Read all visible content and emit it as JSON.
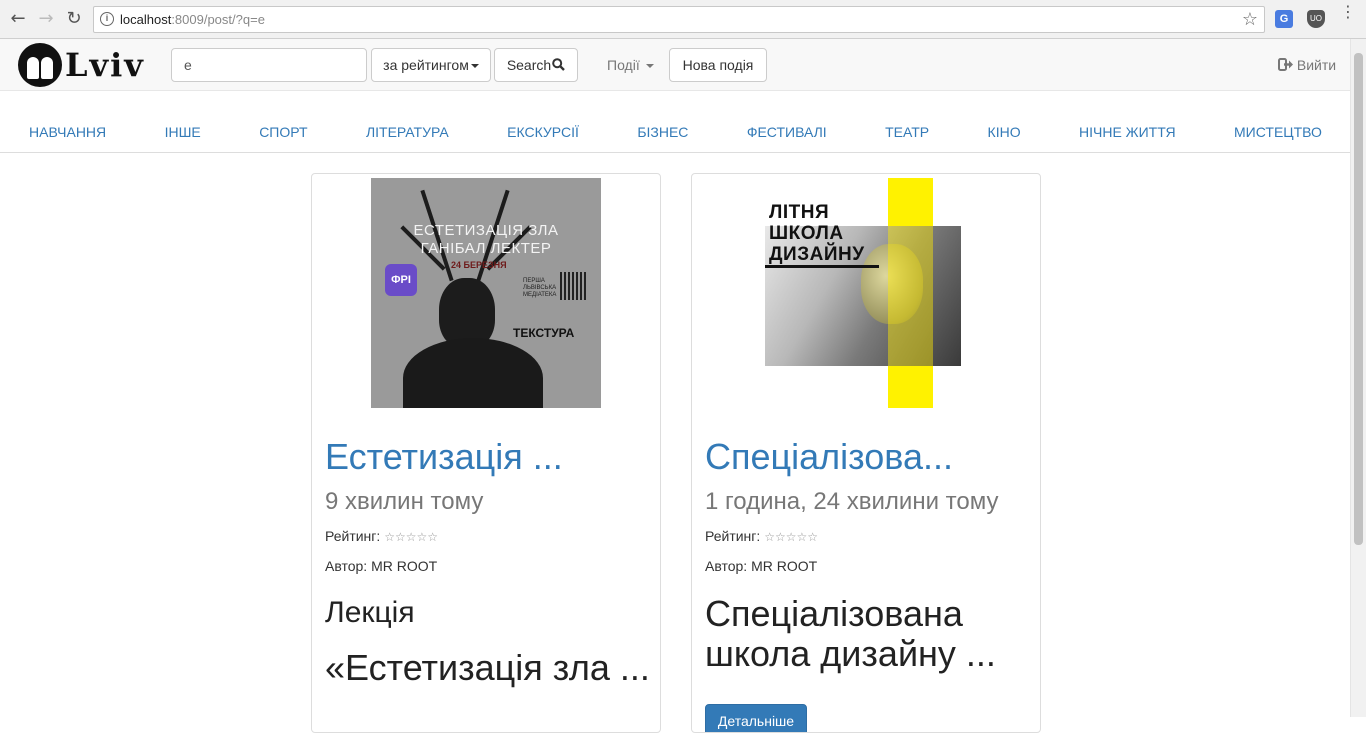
{
  "browser": {
    "url_host": "localhost",
    "url_rest": ":8009/post/?q=e",
    "back_icon": "arrow-left-icon",
    "forward_icon": "arrow-right-icon",
    "reload_icon": "reload-icon",
    "info_icon": "info-icon",
    "star_icon": "bookmark-star-icon",
    "translate_ext_label": "G",
    "shield_ext_label": "UO"
  },
  "navbar": {
    "logo_text": "Lviv",
    "search_value": "e",
    "sort_label": "за рейтингом",
    "search_button_label": "Search",
    "search_icon": "magnifier-icon",
    "events_label": "Події",
    "new_event_label": "Нова подія",
    "logout_label": "Вийти",
    "logout_icon": "sign-out-icon"
  },
  "categories": [
    "Навчання",
    "Інше",
    "Спорт",
    "Література",
    "Екскурсії",
    "Бізнес",
    "Фестивалі",
    "Театр",
    "Кіно",
    "Нічне життя",
    "Мистецтво"
  ],
  "posts": [
    {
      "title": "Естетизація ...",
      "time_ago": "9 хвилин тому",
      "rating_label": "Рейтинг:",
      "rating_stars": "☆☆☆☆☆",
      "author_label": "Автор: MR ROOT",
      "desc_line1": "Лекція",
      "desc_line2": "«Естетизація зла ...",
      "poster": {
        "line1": "ЕСТЕТИЗАЦІЯ ЗЛА",
        "line2": "ГАНІБАЛ ЛЕКТЕР",
        "date": "24 БЕРЕЗНЯ",
        "badge": "ФРІ",
        "library": "ПЕРША ЛЬВІВСЬКА МЕДІАТЕКА",
        "brand": "ТЕКСТУРА"
      }
    },
    {
      "title": "Спеціалізова...",
      "time_ago": "1 година, 24 хвилини тому",
      "rating_label": "Рейтинг:",
      "rating_stars": "☆☆☆☆☆",
      "author_label": "Автор: MR ROOT",
      "desc_line1": "Спеціалізована школа дизайну ...",
      "more_label": "Детальніше",
      "poster": {
        "line1": "ЛІТНЯ",
        "line2": "ШКОЛА",
        "line3": "ДИЗАЙНУ"
      }
    }
  ],
  "colors": {
    "link": "#337ab7",
    "poster_accent": "#fff200"
  }
}
